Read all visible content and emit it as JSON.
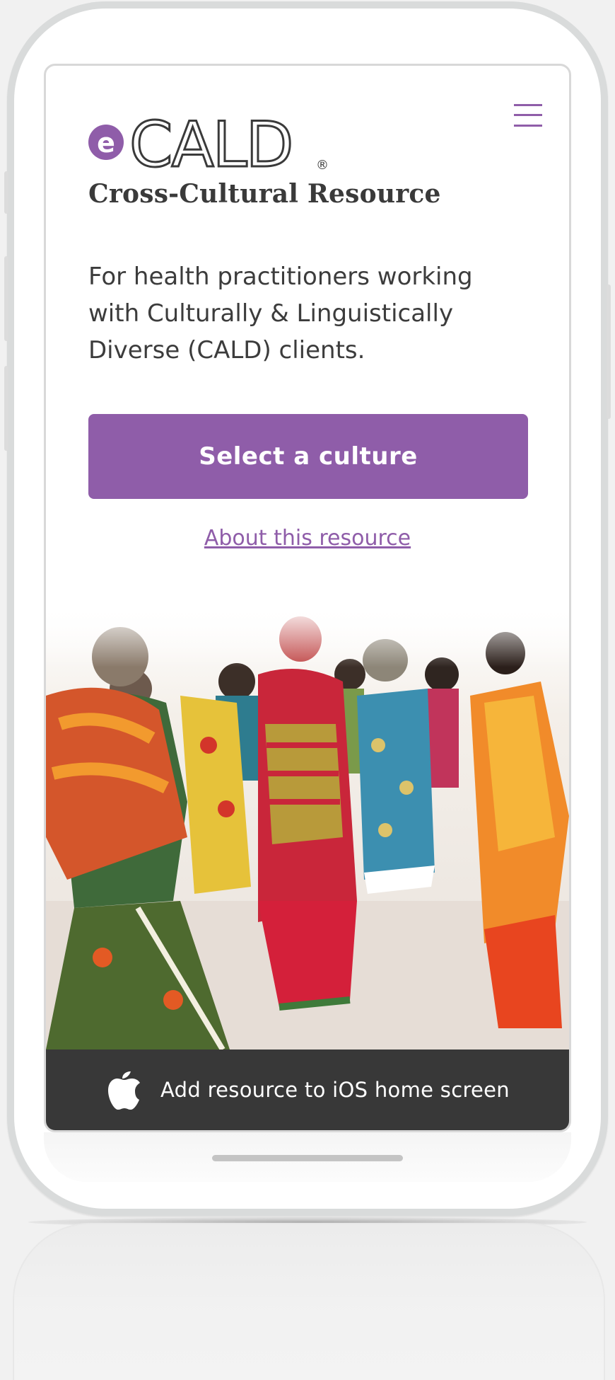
{
  "app": {
    "logo_letter": "e",
    "logo_wordmark": "CALD",
    "logo_registered": "®",
    "subtitle": "Cross-Cultural Resource",
    "description": "For health practitioners working with Culturally & Linguistically Diverse (CALD) clients."
  },
  "menu": {
    "icon": "hamburger-menu-icon"
  },
  "actions": {
    "select_culture_label": "Select a culture",
    "about_link_label": "About this resource"
  },
  "install_banner": {
    "icon": "apple-icon",
    "label": "Add resource to iOS home screen"
  },
  "colors": {
    "brand_purple": "#8f5da9",
    "banner_dark": "#383838",
    "text_dark": "#3a3a3a"
  }
}
